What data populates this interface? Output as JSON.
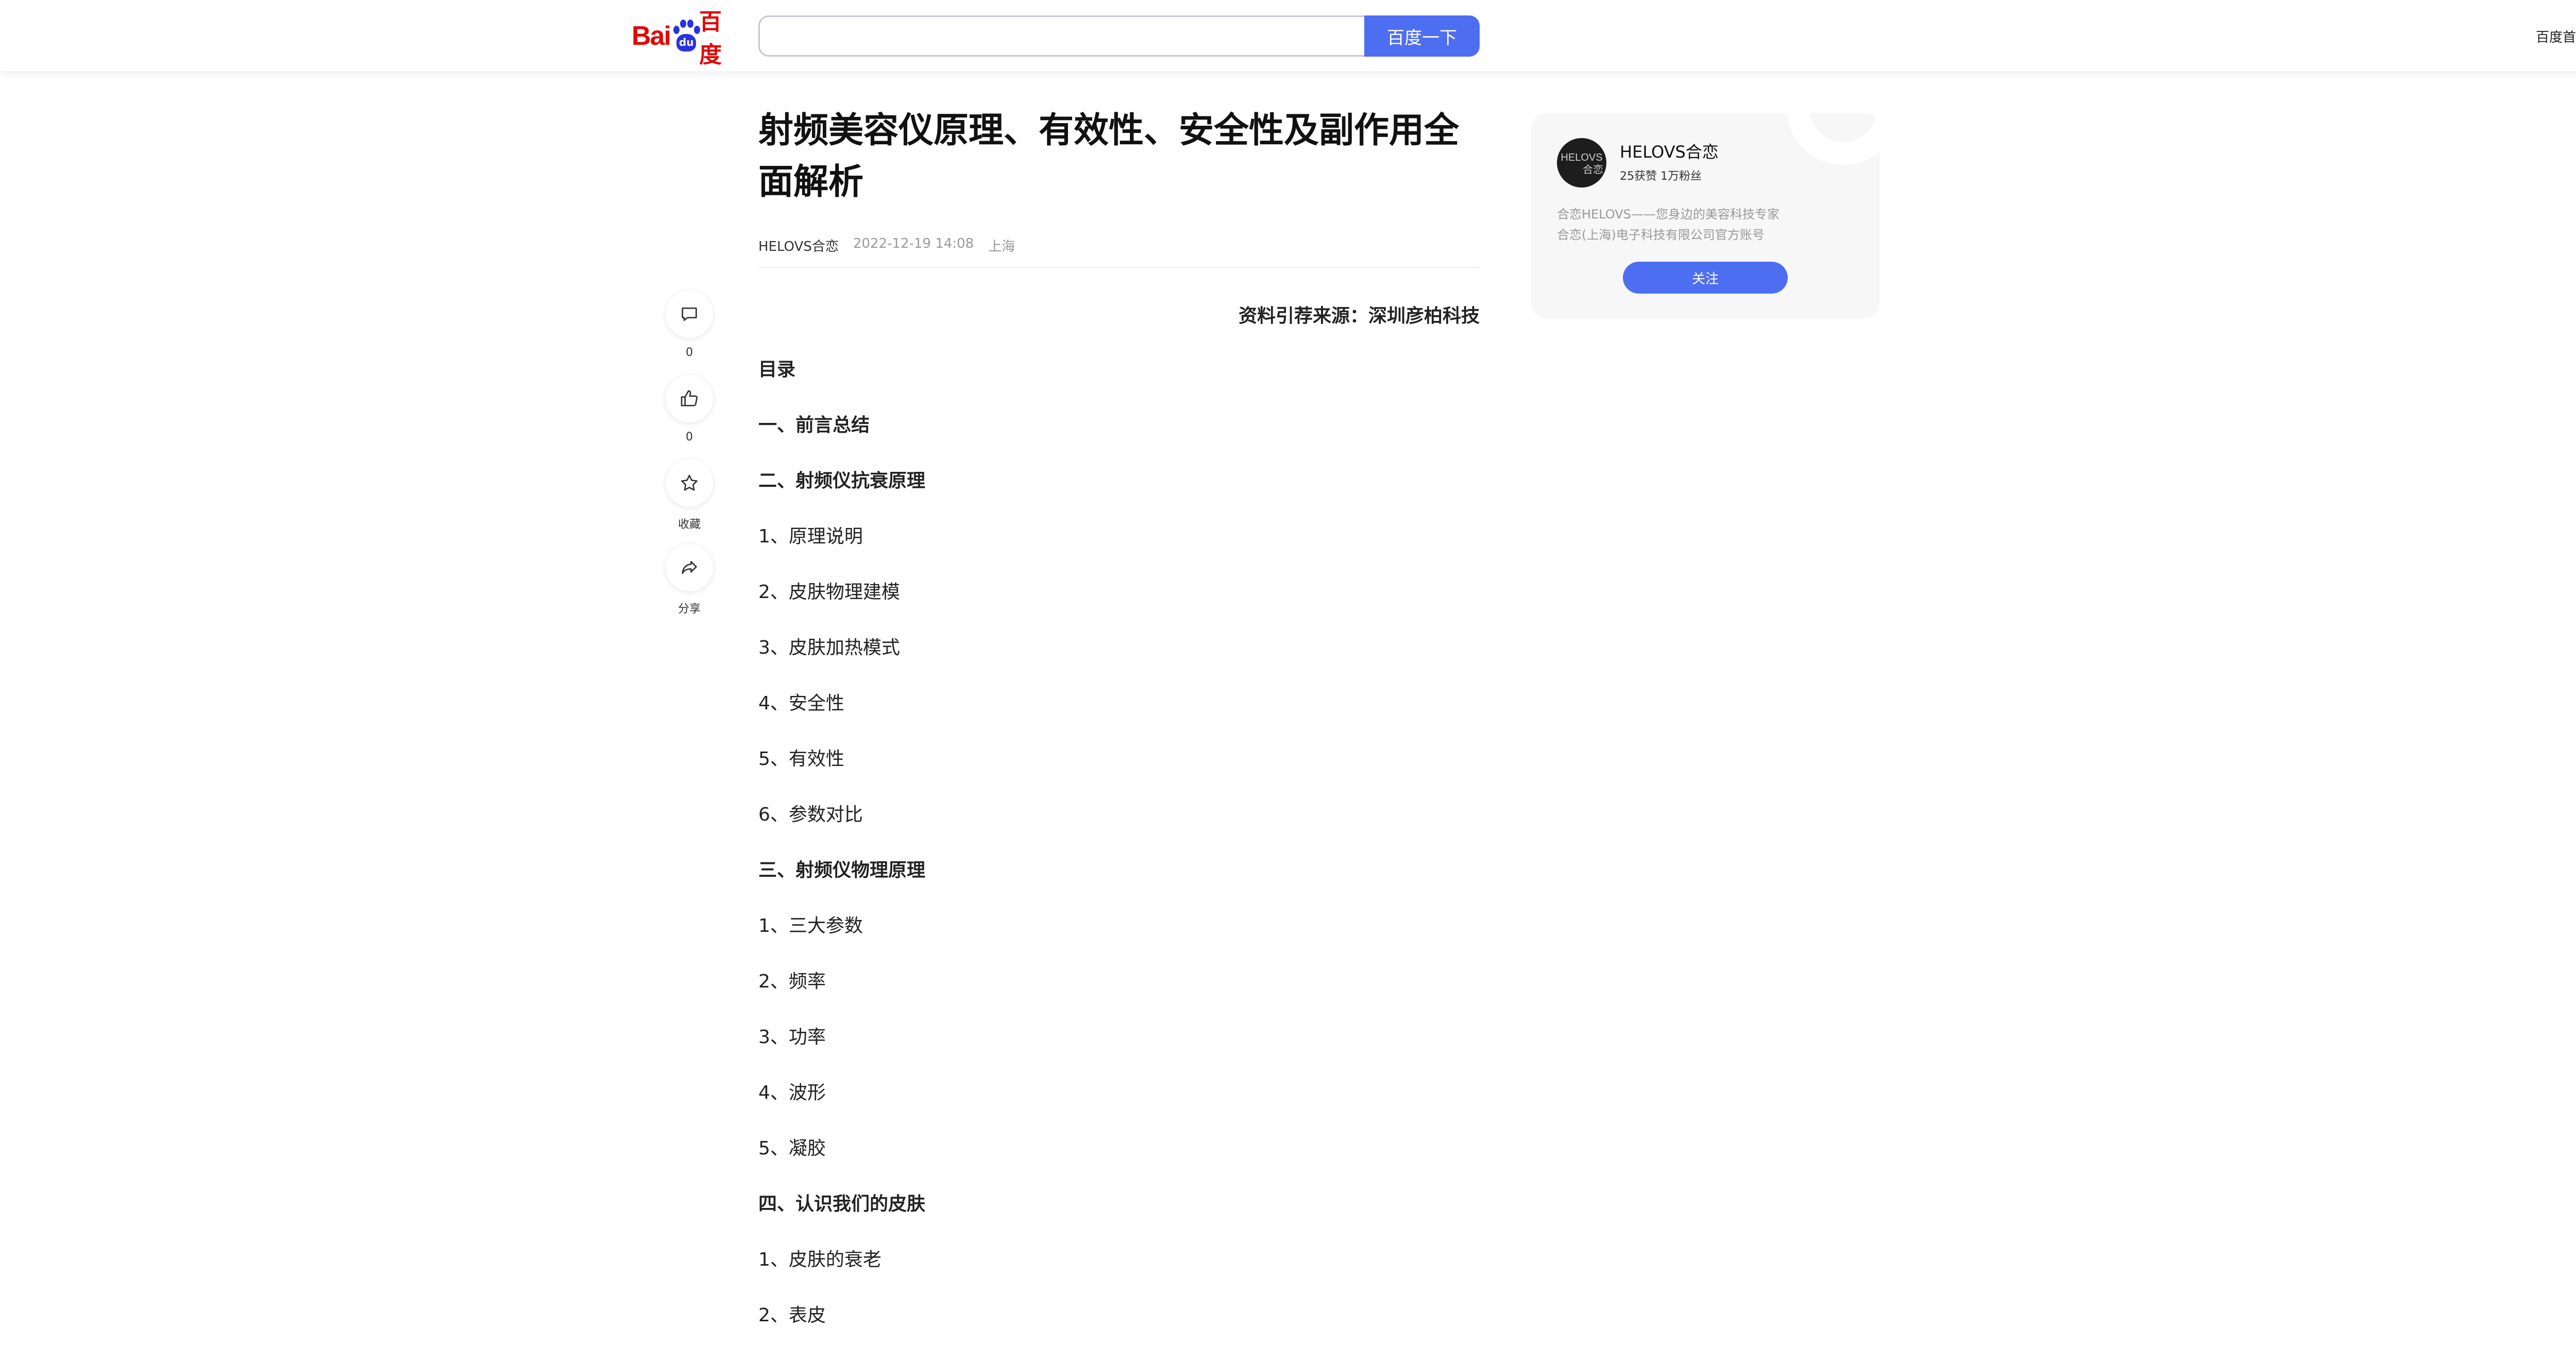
{
  "header": {
    "logo_text_latin": "Bai",
    "logo_paw_text": "du",
    "logo_text_cn": "百度",
    "search_placeholder": "",
    "search_button": "百度一下",
    "home_link": "百度首页"
  },
  "article": {
    "title": "射频美容仪原理、有效性、安全性及副作用全面解析",
    "author": "HELOVS合恋",
    "date": "2022-12-19 14:08",
    "location": "上海",
    "source_line": "资料引荐来源：深圳彦柏科技",
    "toc": [
      {
        "text": "目录",
        "bold": true
      },
      {
        "text": "一、前言总结",
        "bold": true
      },
      {
        "text": "二、射频仪抗衰原理",
        "bold": true
      },
      {
        "text": "1、原理说明",
        "bold": false
      },
      {
        "text": "2、皮肤物理建模",
        "bold": false
      },
      {
        "text": "3、皮肤加热模式",
        "bold": false
      },
      {
        "text": "4、安全性",
        "bold": false
      },
      {
        "text": "5、有效性",
        "bold": false
      },
      {
        "text": "6、参数对比",
        "bold": false
      },
      {
        "text": "三、射频仪物理原理",
        "bold": true
      },
      {
        "text": "1、三大参数",
        "bold": false
      },
      {
        "text": "2、频率",
        "bold": false
      },
      {
        "text": "3、功率",
        "bold": false
      },
      {
        "text": "4、波形",
        "bold": false
      },
      {
        "text": "5、凝胶",
        "bold": false
      },
      {
        "text": "四、认识我们的皮肤",
        "bold": true
      },
      {
        "text": "1、皮肤的衰老",
        "bold": false
      },
      {
        "text": "2、表皮",
        "bold": false
      }
    ]
  },
  "side_actions": {
    "comment_count": "0",
    "like_count": "0",
    "favorite_label": "收藏",
    "share_label": "分享"
  },
  "author_card": {
    "avatar_text_line1": "HELOVS",
    "avatar_text_line2": "合恋",
    "name": "HELOVS合恋",
    "stats": "25获赞 1万粉丝",
    "desc_line1": "合恋HELOVS——您身边的美容科技专家",
    "desc_line2": "合恋(上海)电子科技有限公司官方账号",
    "follow_button": "关注"
  },
  "colors": {
    "accent": "#4e6ef2",
    "logo_red": "#e10602",
    "logo_blue": "#2932e1",
    "muted_text": "#999999"
  }
}
